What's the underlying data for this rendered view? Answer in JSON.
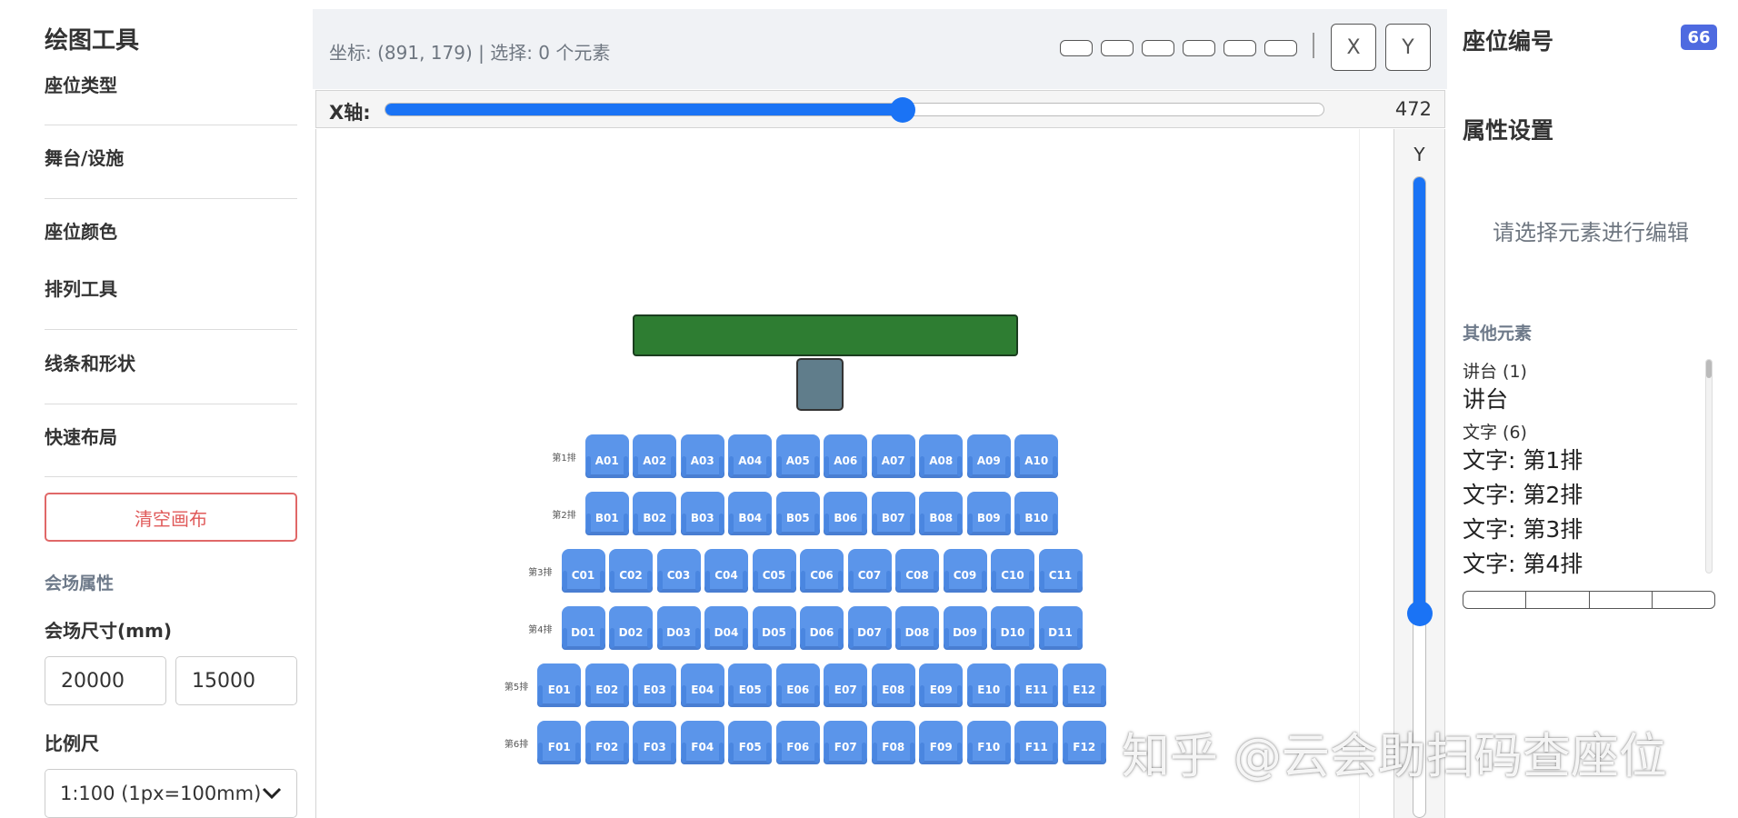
{
  "left_panel": {
    "title": "绘图工具",
    "sections": [
      "座位类型",
      "舞台/设施",
      "座位颜色",
      "排列工具",
      "线条和形状",
      "快速布局"
    ],
    "clear_button": "清空画布",
    "venue_props_title": "会场属性",
    "size_label": "会场尺寸(mm)",
    "width_value": "20000",
    "height_value": "15000",
    "scale_label": "比例尺",
    "scale_value": "1:100 (1px=100mm)"
  },
  "toolbar": {
    "status": "坐标: (891, 179) | 选择: 0 个元素",
    "x_button": "X",
    "y_button": "Y"
  },
  "x_axis": {
    "label": "X轴:",
    "value": "472",
    "fraction": 0.55
  },
  "y_axis": {
    "label": "Y",
    "fraction": 0.68
  },
  "canvas": {
    "row_labels": [
      "第1排",
      "第2排",
      "第3排",
      "第4排",
      "第5排",
      "第6排"
    ],
    "rows": [
      {
        "prefix": "A",
        "count": 10
      },
      {
        "prefix": "B",
        "count": 10
      },
      {
        "prefix": "C",
        "count": 11
      },
      {
        "prefix": "D",
        "count": 11
      },
      {
        "prefix": "E",
        "count": 12
      },
      {
        "prefix": "F",
        "count": 12
      }
    ],
    "stage_color": "#2e7d32",
    "podium_color": "#607d8b",
    "seat_color": "#5b95ea"
  },
  "right_panel": {
    "seat_number_title": "座位编号",
    "seat_count_badge": "66",
    "props_title": "属性设置",
    "hint": "请选择元素进行编辑",
    "other_title": "其他元素",
    "groups": [
      {
        "label": "讲台 (1)",
        "items": [
          "讲台"
        ]
      },
      {
        "label": "文字 (6)",
        "items": [
          "文字: 第1排",
          "文字: 第2排",
          "文字: 第3排",
          "文字: 第4排"
        ]
      }
    ]
  },
  "watermark": "知乎 @云会助扫码查座位",
  "colors": {
    "accent": "#1a73f5",
    "danger": "#e05a5a",
    "badge": "#4e6ae0"
  }
}
